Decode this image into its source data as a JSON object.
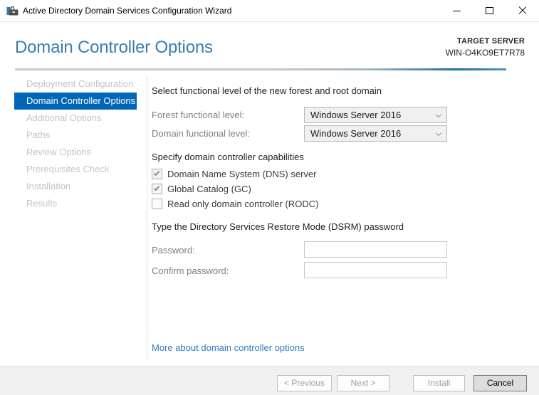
{
  "window": {
    "title": "Active Directory Domain Services Configuration Wizard"
  },
  "icons": {
    "app": "toolbox-icon",
    "minimize": "minimize-icon",
    "maximize": "maximize-icon",
    "close": "close-icon",
    "dropdown": "chevron-down-icon",
    "checkbox_checked": "checkmark-icon"
  },
  "header": {
    "title": "Domain Controller Options",
    "target_label": "TARGET SERVER",
    "target_server": "WIN-O4KO9ET7R78"
  },
  "sidebar": {
    "items": [
      {
        "label": "Deployment Configuration",
        "state": "visited"
      },
      {
        "label": "Domain Controller Options",
        "state": "current"
      },
      {
        "label": "Additional Options",
        "state": "pending"
      },
      {
        "label": "Paths",
        "state": "pending"
      },
      {
        "label": "Review Options",
        "state": "pending"
      },
      {
        "label": "Prerequisites Check",
        "state": "pending"
      },
      {
        "label": "Installation",
        "state": "pending"
      },
      {
        "label": "Results",
        "state": "pending"
      }
    ]
  },
  "content": {
    "functional_levels": {
      "heading": "Select functional level of the new forest and root domain",
      "forest": {
        "label": "Forest functional level:",
        "value": "Windows Server 2016"
      },
      "domain": {
        "label": "Domain functional level:",
        "value": "Windows Server 2016"
      }
    },
    "capabilities": {
      "heading": "Specify domain controller capabilities",
      "dns": {
        "label": "Domain Name System (DNS) server",
        "checked": true
      },
      "gc": {
        "label": "Global Catalog (GC)",
        "checked": true
      },
      "rodc": {
        "label": "Read only domain controller (RODC)",
        "checked": false
      }
    },
    "dsrm": {
      "heading": "Type the Directory Services Restore Mode (DSRM) password",
      "password": {
        "label": "Password:",
        "value": ""
      },
      "confirm": {
        "label": "Confirm password:",
        "value": ""
      }
    },
    "link": "More about domain controller options"
  },
  "footer": {
    "previous": {
      "label": "< Previous",
      "enabled": false
    },
    "next": {
      "label": "Next >",
      "enabled": false
    },
    "install": {
      "label": "Install",
      "enabled": false
    },
    "cancel": {
      "label": "Cancel",
      "enabled": true
    }
  },
  "colors": {
    "accent": "#0067b8",
    "header_title": "#3a7dad",
    "divider_blue": "#2273a2",
    "link": "#3079c5",
    "footer_bg": "#f0f0f0"
  }
}
